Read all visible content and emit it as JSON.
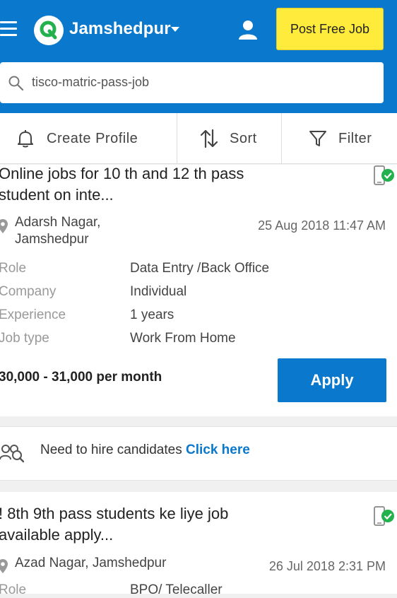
{
  "header": {
    "city": "Jamshedpur",
    "post_job_label": "Post Free Job",
    "search_value": "tisco-matric-pass-job"
  },
  "toolbar": {
    "create_profile": "Create Profile",
    "sort": "Sort",
    "filter": "Filter"
  },
  "jobs": [
    {
      "title": "Online jobs for 10 th and 12 th pass student on inte...",
      "location_line1": "Adarsh Nagar,",
      "location_line2": "Jamshedpur",
      "date": "25 Aug 2018 11:47 AM",
      "labels": [
        "Role",
        "Company",
        "Experience",
        "Job type"
      ],
      "values": [
        "Data Entry /Back Office",
        "Individual",
        "1 years",
        "Work From Home"
      ],
      "salary": "30,000 - 31,000 per month",
      "apply_label": "Apply"
    },
    {
      "title": "! 8th 9th pass students ke liye job available apply...",
      "location_line1": "Azad Nagar, Jamshedpur",
      "date": "26 Jul 2018 2:31 PM",
      "labels": [
        "Role"
      ],
      "values": [
        "BPO/ Telecaller"
      ]
    }
  ],
  "hire_banner": {
    "text": "Need to hire candidates",
    "link": "Click here"
  },
  "colors": {
    "brand_blue": "#0a78cc",
    "post_job_yellow": "#ffeb3b",
    "verified_green": "#22b14c"
  },
  "icons": [
    "menu-icon",
    "logo-icon",
    "user-icon",
    "search-icon",
    "bell-icon",
    "sort-icon",
    "filter-icon",
    "verified-phone-icon",
    "location-icon",
    "hire-icon"
  ]
}
